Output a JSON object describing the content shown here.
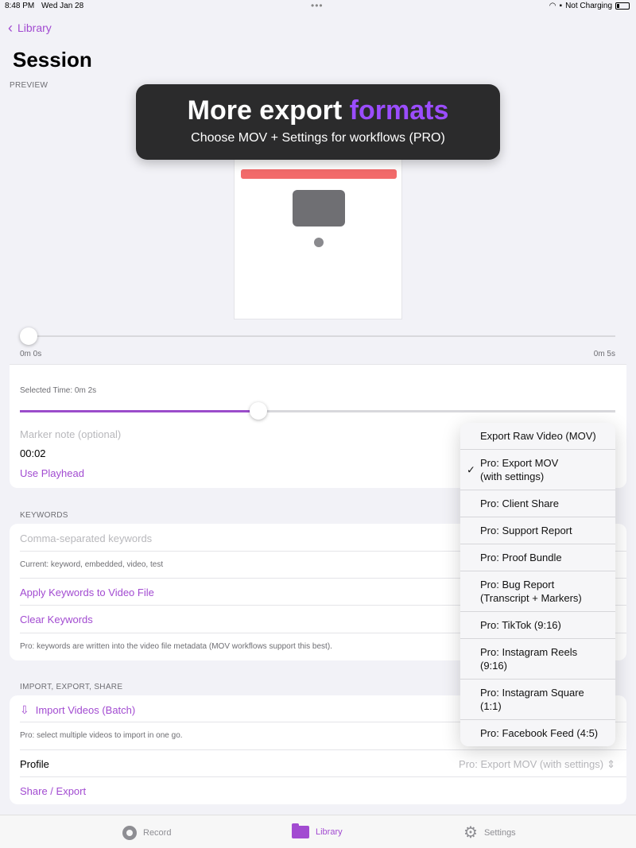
{
  "status": {
    "time": "8:48 PM",
    "date": "Wed Jan 28",
    "charging": "Not Charging"
  },
  "nav": {
    "back_label": "Library",
    "title": "Session"
  },
  "preview": {
    "section_label": "PREVIEW"
  },
  "banner": {
    "title_part1": "More export",
    "title_accent": "formats",
    "subtitle": "Choose MOV + Settings for workflows (PRO)"
  },
  "timeline": {
    "start_label": "0m 0s",
    "end_label": "0m 5s",
    "position_fraction": 0.0
  },
  "markers": {
    "selected_time": "Selected Time: 0m 2s",
    "slider_fraction": 0.4,
    "note_placeholder": "Marker note (optional)",
    "time_value": "00:02",
    "use_playhead": "Use Playhead"
  },
  "keywords": {
    "section_label": "KEYWORDS",
    "placeholder": "Comma-separated keywords",
    "current": "Current: keyword, embedded, video, test",
    "apply": "Apply Keywords to Video File",
    "clear": "Clear Keywords",
    "hint": "Pro: keywords are written into the video file metadata (MOV workflows support this best)."
  },
  "import_export": {
    "section_label": "IMPORT, EXPORT, SHARE",
    "import_label": "Import Videos (Batch)",
    "import_hint": "Pro: select multiple videos to import in one go.",
    "profile_label": "Profile",
    "profile_value": "Pro: Export MOV (with settings)",
    "share_label": "Share / Export"
  },
  "menu": {
    "items": [
      {
        "label": "Export Raw Video (MOV)",
        "checked": false
      },
      {
        "label": "Pro: Export MOV\n(with settings)",
        "checked": true
      },
      {
        "label": "Pro: Client Share",
        "checked": false
      },
      {
        "label": "Pro: Support Report",
        "checked": false
      },
      {
        "label": "Pro: Proof Bundle",
        "checked": false
      },
      {
        "label": "Pro: Bug Report\n(Transcript + Markers)",
        "checked": false
      },
      {
        "label": "Pro: TikTok (9:16)",
        "checked": false
      },
      {
        "label": "Pro: Instagram Reels\n(9:16)",
        "checked": false
      },
      {
        "label": "Pro: Instagram Square\n(1:1)",
        "checked": false
      },
      {
        "label": "Pro: Facebook Feed (4:5)",
        "checked": false
      }
    ],
    "check_glyph": "✓"
  },
  "tabs": {
    "record": "Record",
    "library": "Library",
    "settings": "Settings"
  },
  "colors": {
    "accent": "#a24bd1",
    "banner_accent": "#9b4dff"
  }
}
